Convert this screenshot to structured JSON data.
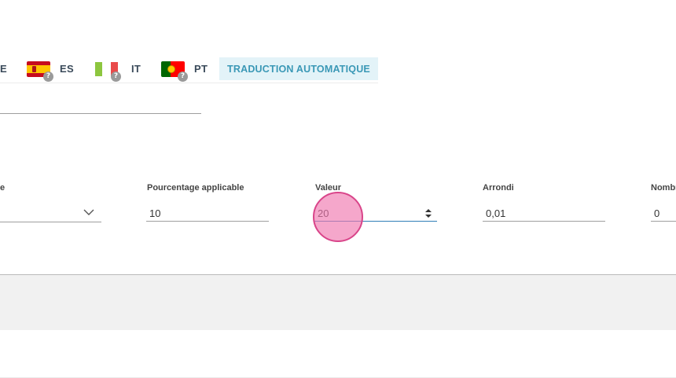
{
  "tabs": {
    "partial_label": "E",
    "languages": [
      {
        "code": "ES",
        "flag": "spain-flag-icon",
        "badge": "?"
      },
      {
        "code": "IT",
        "flag": "italy-flag-icon",
        "badge": "?"
      },
      {
        "code": "PT",
        "flag": "portugal-flag-icon",
        "badge": "?"
      }
    ],
    "auto_translate_label": "TRADUCTION AUTOMATIQUE"
  },
  "form": {
    "field1": {
      "label": "e",
      "value": ""
    },
    "percentage": {
      "label": "Pourcentage applicable",
      "value": "10"
    },
    "valeur": {
      "label": "Valeur",
      "value": "20"
    },
    "arrondi": {
      "label": "Arrondi",
      "value": "0,01"
    },
    "nombre": {
      "label": "Nombr",
      "value": "0"
    }
  },
  "colors": {
    "accent": "#3a98b6",
    "tab_bg": "#e3f3f8",
    "click_indicator": "#f078af"
  }
}
